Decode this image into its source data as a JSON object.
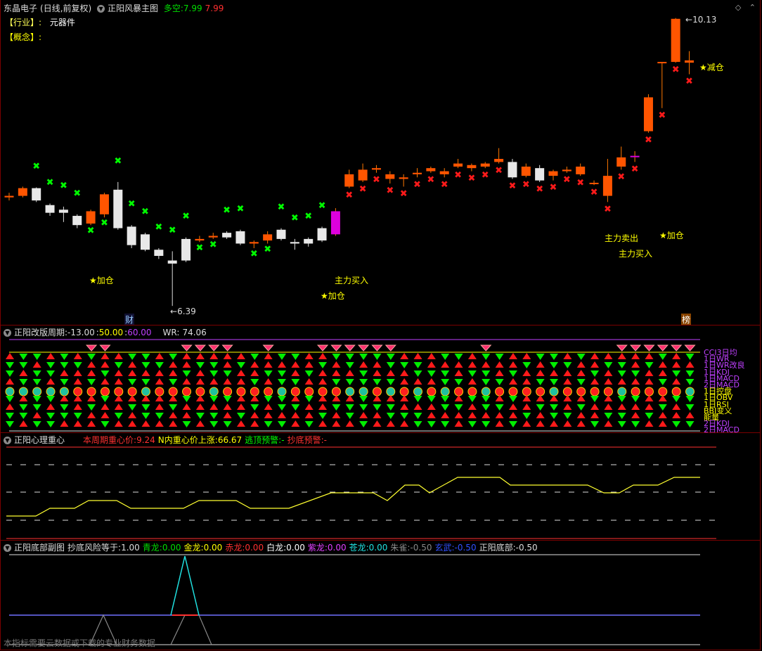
{
  "main": {
    "stock_name": "东晶电子",
    "adjust_mode": "(日线,前复权)",
    "indicator_name": "正阳风暴主图",
    "duokong_label": "多空:",
    "duokong_val1": "7.99",
    "duokong_val2": "7.99",
    "industry_label": "【行业】:",
    "industry_value": "元器件",
    "concept_label": "【概念】:",
    "high_label": "10.13",
    "low_label": "6.39",
    "annotations": {
      "jiacang": "★加仓",
      "jiancang": "★减仓",
      "zhuli_mairu": "主力买入",
      "zhuli_maichu": "主力卖出",
      "cai": "财",
      "bang": "榜"
    },
    "colors": {
      "up": "#ff4400",
      "down": "#ffffff",
      "green_x": "#00ff00",
      "red_x": "#ff1a1a",
      "magenta": "#ff00ff",
      "yellow": "#ffff00"
    }
  },
  "cycle": {
    "title": "正阳改版周期:",
    "v1": "-13.00",
    "v2": "50.00",
    "v3": "60.00",
    "wr_label": "WR:",
    "wr_value": "74.06",
    "legend": [
      "CCI3日均",
      "1日WR",
      "1日WR改良",
      "1日KDJ",
      "1日MACD",
      "2日MACD",
      "1日控盘",
      "1日OBV",
      "1日RSI",
      "BBI变义",
      "能量",
      "2日KDJ",
      "2日MACD"
    ]
  },
  "heart": {
    "title": "正阳心理重心",
    "weekly_label": "本周期重心价:",
    "weekly_value": "9.24",
    "n_label": "N内重心价上涨:",
    "n_value": "66.67",
    "top_warn_label": "逃顶预警:",
    "top_warn_value": "-",
    "bottom_warn_label": "抄底预警:",
    "bottom_warn_value": "-"
  },
  "bottom": {
    "title": "正阳底部副图",
    "risk_label": "抄底风险等于:",
    "risk_value": "1.00",
    "qinglong_label": "青龙:",
    "qinglong_value": "0.00",
    "jinlong_label": "金龙:",
    "jinlong_value": "0.00",
    "chilong_label": "赤龙:",
    "chilong_value": "0.00",
    "bailong_label": "白龙:",
    "bailong_value": "0.00",
    "zilong_label": "紫龙:",
    "zilong_value": "0.00",
    "canglong_label": "苍龙:",
    "canglong_value": "0.00",
    "zhuque_label": "朱雀:",
    "zhuque_value": "-0.50",
    "xuanwu_label": "玄武:",
    "xuanwu_value": "-0.50",
    "zyd_label": "正阳底部:",
    "zyd_value": "-0.50",
    "footer_note": "本指标需要云数据或下载的专业财务数据"
  },
  "chart_data": {
    "type": "candlestick",
    "candles": [
      [
        7.8,
        7.82,
        7.86,
        7.76
      ],
      [
        7.82,
        7.92,
        7.94,
        7.8
      ],
      [
        7.92,
        7.76,
        7.93,
        7.74
      ],
      [
        7.7,
        7.6,
        7.72,
        7.56
      ],
      [
        7.64,
        7.6,
        7.68,
        7.48
      ],
      [
        7.56,
        7.44,
        7.58,
        7.4
      ],
      [
        7.46,
        7.62,
        7.64,
        7.44
      ],
      [
        7.58,
        7.84,
        7.86,
        7.54
      ],
      [
        7.9,
        7.4,
        8.0,
        7.38
      ],
      [
        7.42,
        7.18,
        7.44,
        7.14
      ],
      [
        7.32,
        7.12,
        7.34,
        7.1
      ],
      [
        7.12,
        7.04,
        7.14,
        7.0
      ],
      [
        6.98,
        6.94,
        7.1,
        6.39
      ],
      [
        7.26,
        6.98,
        7.28,
        6.96
      ],
      [
        7.24,
        7.26,
        7.3,
        7.22
      ],
      [
        7.28,
        7.3,
        7.34,
        7.26
      ],
      [
        7.34,
        7.28,
        7.36,
        7.26
      ],
      [
        7.36,
        7.2,
        7.38,
        7.18
      ],
      [
        7.2,
        7.22,
        7.24,
        7.14
      ],
      [
        7.24,
        7.32,
        7.36,
        7.2
      ],
      [
        7.38,
        7.26,
        7.4,
        7.24
      ],
      [
        7.22,
        7.2,
        7.26,
        7.12
      ],
      [
        7.26,
        7.2,
        7.28,
        7.16
      ],
      [
        7.4,
        7.24,
        7.42,
        7.22
      ],
      [
        7.32,
        7.62,
        7.66,
        7.3
      ],
      [
        7.94,
        8.1,
        8.16,
        7.92
      ],
      [
        8.02,
        8.16,
        8.24,
        8.0
      ],
      [
        8.16,
        8.18,
        8.22,
        8.12
      ],
      [
        8.04,
        8.1,
        8.14,
        7.98
      ],
      [
        8.04,
        8.06,
        8.1,
        7.94
      ],
      [
        8.1,
        8.12,
        8.18,
        8.06
      ],
      [
        8.14,
        8.18,
        8.2,
        8.12
      ],
      [
        8.1,
        8.14,
        8.18,
        8.06
      ],
      [
        8.2,
        8.24,
        8.3,
        8.18
      ],
      [
        8.18,
        8.22,
        8.24,
        8.14
      ],
      [
        8.2,
        8.24,
        8.26,
        8.18
      ],
      [
        8.26,
        8.3,
        8.44,
        8.24
      ],
      [
        8.26,
        8.06,
        8.3,
        8.04
      ],
      [
        8.08,
        8.2,
        8.24,
        8.06
      ],
      [
        8.18,
        8.02,
        8.22,
        8.0
      ],
      [
        8.08,
        8.14,
        8.16,
        8.02
      ],
      [
        8.14,
        8.16,
        8.2,
        8.12
      ],
      [
        8.1,
        8.2,
        8.24,
        8.08
      ],
      [
        7.99,
        7.99,
        8.02,
        7.96
      ],
      [
        7.82,
        8.08,
        8.3,
        7.74
      ],
      [
        8.2,
        8.32,
        8.46,
        8.16
      ],
      [
        8.34,
        8.34,
        8.4,
        8.26
      ],
      [
        8.66,
        9.1,
        9.14,
        8.64
      ],
      [
        9.56,
        9.56,
        9.56,
        8.96
      ],
      [
        9.56,
        10.12,
        10.13,
        9.55
      ],
      [
        9.55,
        9.58,
        9.7,
        9.4
      ]
    ],
    "high": 10.13,
    "low": 6.39
  }
}
